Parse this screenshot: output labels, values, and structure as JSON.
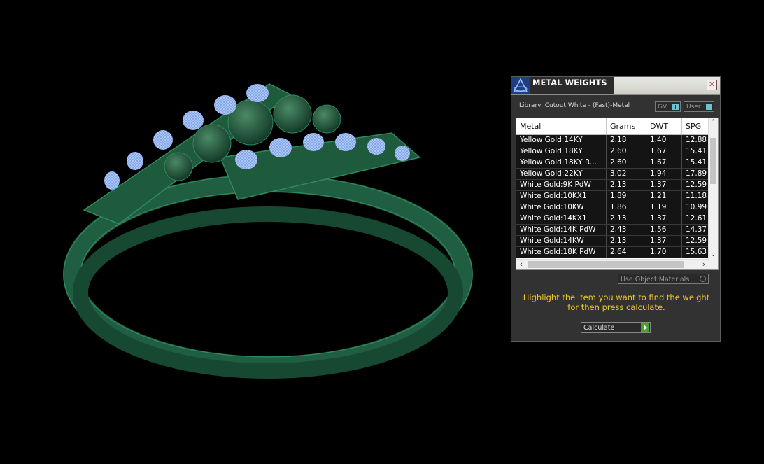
{
  "panel": {
    "title": "METAL WEIGHTS",
    "close_label": "✕",
    "library": "Library: Cutout White - (Fast)-Metal",
    "toggle_gv": "GV",
    "toggle_user": "User",
    "columns": [
      "Metal",
      "Grams",
      "DWT",
      "SPG"
    ],
    "rows": [
      [
        "Yellow Gold:14KY",
        "2.18",
        "1.40",
        "12.88"
      ],
      [
        "Yellow Gold:18KY",
        "2.60",
        "1.67",
        "15.41"
      ],
      [
        "Yellow Gold:18KY R...",
        "2.60",
        "1.67",
        "15.41"
      ],
      [
        "Yellow Gold:22KY",
        "3.02",
        "1.94",
        "17.89"
      ],
      [
        "White Gold:9K PdW",
        "2.13",
        "1.37",
        "12.59"
      ],
      [
        "White Gold:10KX1",
        "1.89",
        "1.21",
        "11.18"
      ],
      [
        "White Gold:10KW",
        "1.86",
        "1.19",
        "10.99"
      ],
      [
        "White Gold:14KX1",
        "2.13",
        "1.37",
        "12.61"
      ],
      [
        "White Gold:14K PdW",
        "2.43",
        "1.56",
        "14.37"
      ],
      [
        "White Gold:14KW",
        "2.13",
        "1.37",
        "12.59"
      ],
      [
        "White Gold:18K PdW",
        "2.64",
        "1.70",
        "15.63"
      ]
    ],
    "use_object_materials": "Use Object Materials",
    "hint": "Highlight the item you want to find the weight for then press calculate.",
    "calculate_label": "Calculate",
    "scroll_up": "⌃",
    "scroll_down": "⌄",
    "scroll_left": "‹",
    "scroll_right": "›"
  },
  "viewport": {
    "model_color": "#1e5a3c",
    "stone_color": "#8fb4f0"
  }
}
